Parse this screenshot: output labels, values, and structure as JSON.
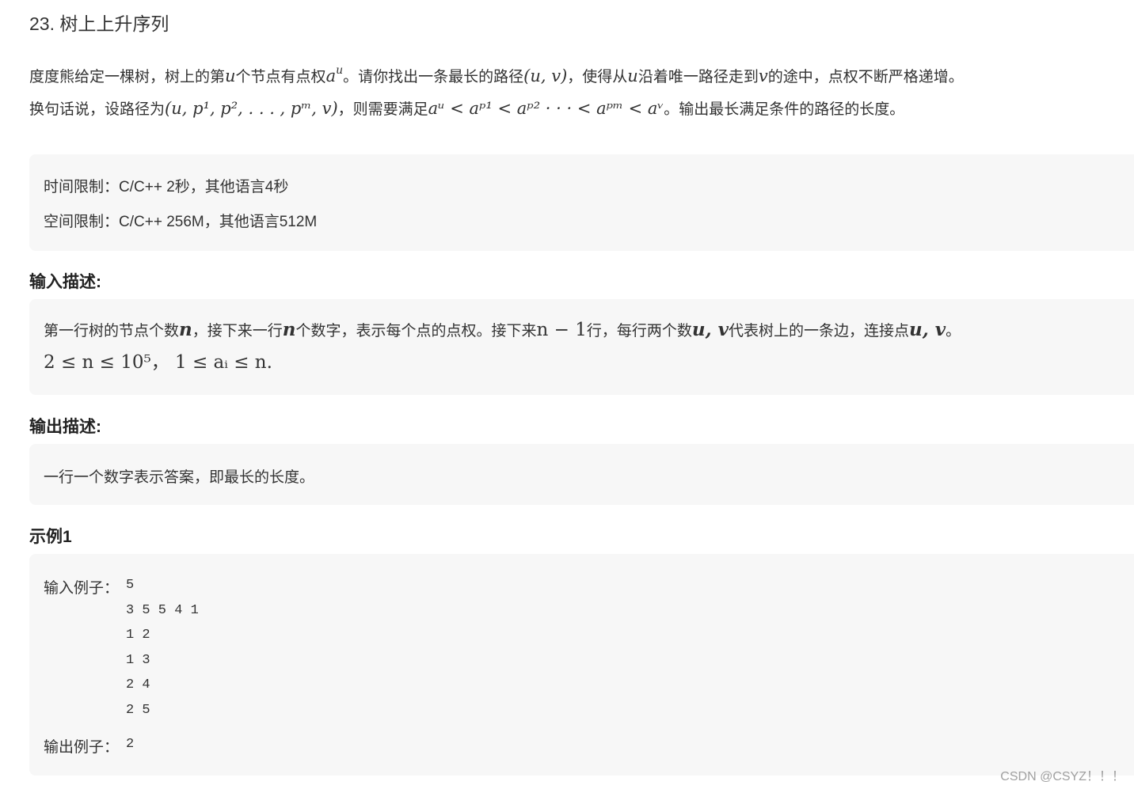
{
  "title": "23. 树上上升序列",
  "problem": {
    "line1_a": "度度熊给定一棵树，树上的第",
    "line1_u": "u",
    "line1_b": "个节点有点权",
    "line1_au_base": "a",
    "line1_au_sup": "u",
    "line1_c": "。请你找出一条最长的路径",
    "line1_path": "(u, v)",
    "line1_d": "，使得从",
    "line1_u2": "u",
    "line1_e": "沿着唯一路径走到",
    "line1_v": "v",
    "line1_f": "的途中，点权不断严格递增。",
    "line2_a": "换句话说，设路径为",
    "line2_path": "(u, p¹, p², . . . , pᵐ, v)",
    "line2_b": "，则需要满足",
    "line2_cond": "aᵘ < aᵖ¹ < aᵖ² · · · < aᵖᵐ < aᵛ",
    "line2_c": "。输出最长满足条件的路径的长度。"
  },
  "limits": {
    "time": "时间限制：C/C++ 2秒，其他语言4秒",
    "space": "空间限制：C/C++ 256M，其他语言512M"
  },
  "input_section": {
    "heading": "输入描述:",
    "text_a": "第一行树的节点个数",
    "n": "n",
    "text_b": "，接下来一行",
    "n2": "n",
    "text_c": "个数字，表示每个点的点权。接下来",
    "nminus": "n − 1",
    "text_d": "行，每行两个数",
    "uv": "u, v",
    "text_e": "代表树上的一条边，连接点",
    "uv2": "u, v",
    "text_f": "。",
    "constraint": "2 ≤ n ≤ 10⁵， 1 ≤ aᵢ ≤ n."
  },
  "output_section": {
    "heading": "输出描述:",
    "text": "一行一个数字表示答案，即最长的长度。"
  },
  "example": {
    "heading": "示例1",
    "input_label": "输入例子：",
    "input_lines": [
      "5",
      "3 5 5 4 1",
      "1 2",
      "1 3",
      "2 4",
      "2 5"
    ],
    "output_label": "输出例子：",
    "output_value": "2"
  },
  "watermark": "CSDN @CSYZ！！！"
}
